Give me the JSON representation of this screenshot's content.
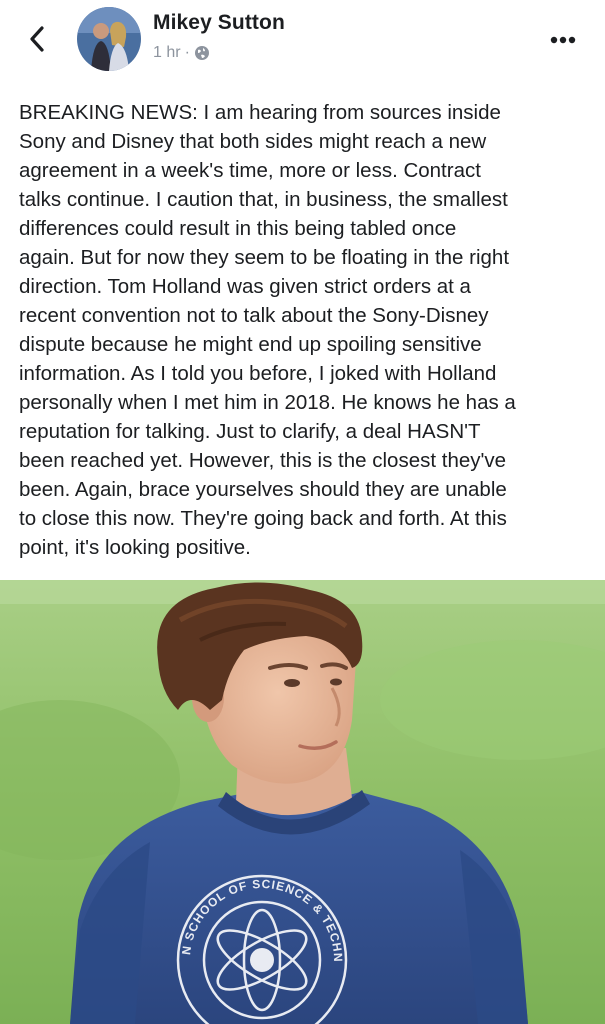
{
  "header": {
    "back_icon": "chevron-left-icon",
    "author_name": "Mikey Sutton",
    "timestamp": "1 hr",
    "separator": "·",
    "privacy_icon": "globe-icon",
    "more_icon": "more-horizontal-icon"
  },
  "post": {
    "lines": [
      "BREAKING NEWS: I am hearing from sources inside",
      "Sony and Disney that both sides might reach a new",
      "agreement in a week's time, more or less. Contract",
      "talks continue. I caution that, in business, the smallest",
      "differences could result in this being tabled once",
      "again. But for now they seem to be floating in the right",
      "direction. Tom Holland was given strict orders at a",
      "recent convention not to talk about the Sony-Disney",
      "dispute because he might end up spoiling sensitive",
      "information. As I told you before, I joked with Holland",
      "personally when I met him in 2018. He knows he has a",
      "reputation for talking. Just to clarify, a deal HASN'T",
      "been reached yet. However, this is the closest they've",
      "been. Again, brace yourselves should they are unable",
      "to close this now. They're going back and forth. At this",
      "point, it's looking positive."
    ]
  },
  "photo": {
    "sweatshirt_logo_text": "MIDTOWN SCHOOL OF SCIENCE & TECHNOLOGY",
    "colors": {
      "grass": "#8fbf66",
      "sweatshirt": "#33508f",
      "hair": "#5a3420",
      "skin": "#e6b89c"
    }
  }
}
